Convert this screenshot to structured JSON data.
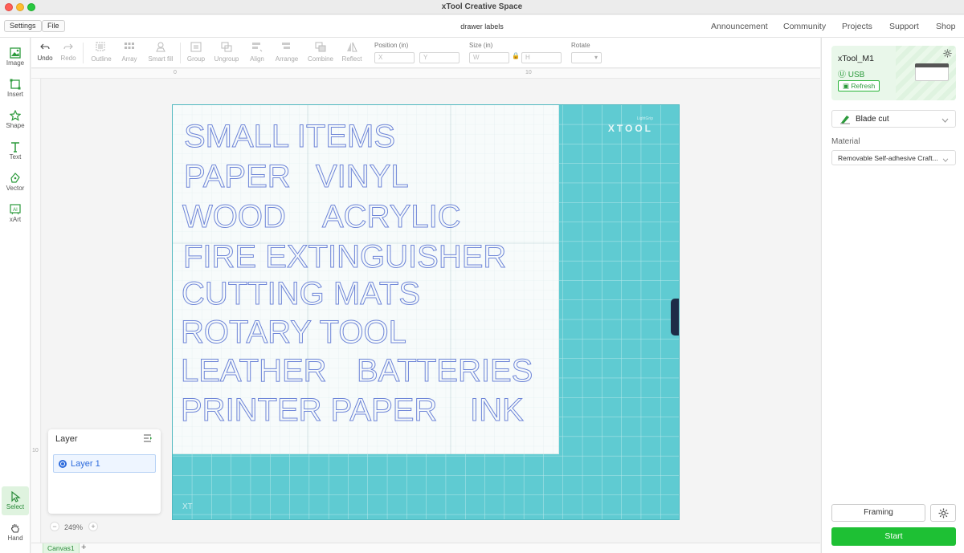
{
  "window": {
    "title": "xTool Creative Space"
  },
  "menu": {
    "settings": "Settings",
    "file": "File",
    "doc_title": "drawer labels"
  },
  "nav": [
    "Announcement",
    "Community",
    "Projects",
    "Support",
    "Shop"
  ],
  "left_tools": [
    {
      "label": "Image",
      "icon": "image-icon"
    },
    {
      "label": "Insert",
      "icon": "insert-icon"
    },
    {
      "label": "Shape",
      "icon": "shape-icon"
    },
    {
      "label": "Text",
      "icon": "text-icon"
    },
    {
      "label": "Vector",
      "icon": "vector-icon"
    },
    {
      "label": "xArt",
      "icon": "xart-icon"
    }
  ],
  "bottom_tools": [
    {
      "label": "Select",
      "icon": "select-icon",
      "active": true
    },
    {
      "label": "Hand",
      "icon": "hand-icon",
      "active": false
    }
  ],
  "toolbar": {
    "undo": "Undo",
    "redo": "Redo",
    "outline": "Outline",
    "array": "Array",
    "smart_fill": "Smart fill",
    "group": "Group",
    "ungroup": "Ungroup",
    "align": "Align",
    "arrange": "Arrange",
    "combine": "Combine",
    "reflect": "Reflect",
    "position_label": "Position (in)",
    "x_placeholder": "X",
    "y_placeholder": "Y",
    "size_label": "Size (in)",
    "w_placeholder": "W",
    "h_placeholder": "H",
    "rotate_label": "Rotate"
  },
  "ruler": {
    "top": [
      "0",
      "10"
    ],
    "left": [
      "10"
    ]
  },
  "mat": {
    "brand": "XTOOL",
    "brand_small": "LightGrip",
    "corner": "XT"
  },
  "labels": [
    [
      "SMALL ITEMS"
    ],
    [
      "PAPER",
      "VINYL"
    ],
    [
      "WOOD",
      "ACRYLIC"
    ],
    [
      "FIRE EXTINGUISHER"
    ],
    [
      "CUTTING MATS"
    ],
    [
      "ROTARY TOOL"
    ],
    [
      "LEATHER",
      "BATTERIES"
    ],
    [
      "PRINTER PAPER",
      "INK"
    ]
  ],
  "layer_panel": {
    "title": "Layer",
    "layers": [
      "Layer 1"
    ]
  },
  "zoom": {
    "value": "249%"
  },
  "canvas_tabs": [
    "Canvas1"
  ],
  "device": {
    "name": "xTool_M1",
    "connection": "USB",
    "refresh": "Refresh"
  },
  "mode": {
    "selected": "Blade cut"
  },
  "material": {
    "label": "Material",
    "selected": "Removable Self-adhesive Craft..."
  },
  "actions": {
    "framing": "Framing",
    "start": "Start"
  },
  "colors": {
    "accent": "#1ec034",
    "mat": "#5fcbd2",
    "outline": "#6f86d8"
  }
}
